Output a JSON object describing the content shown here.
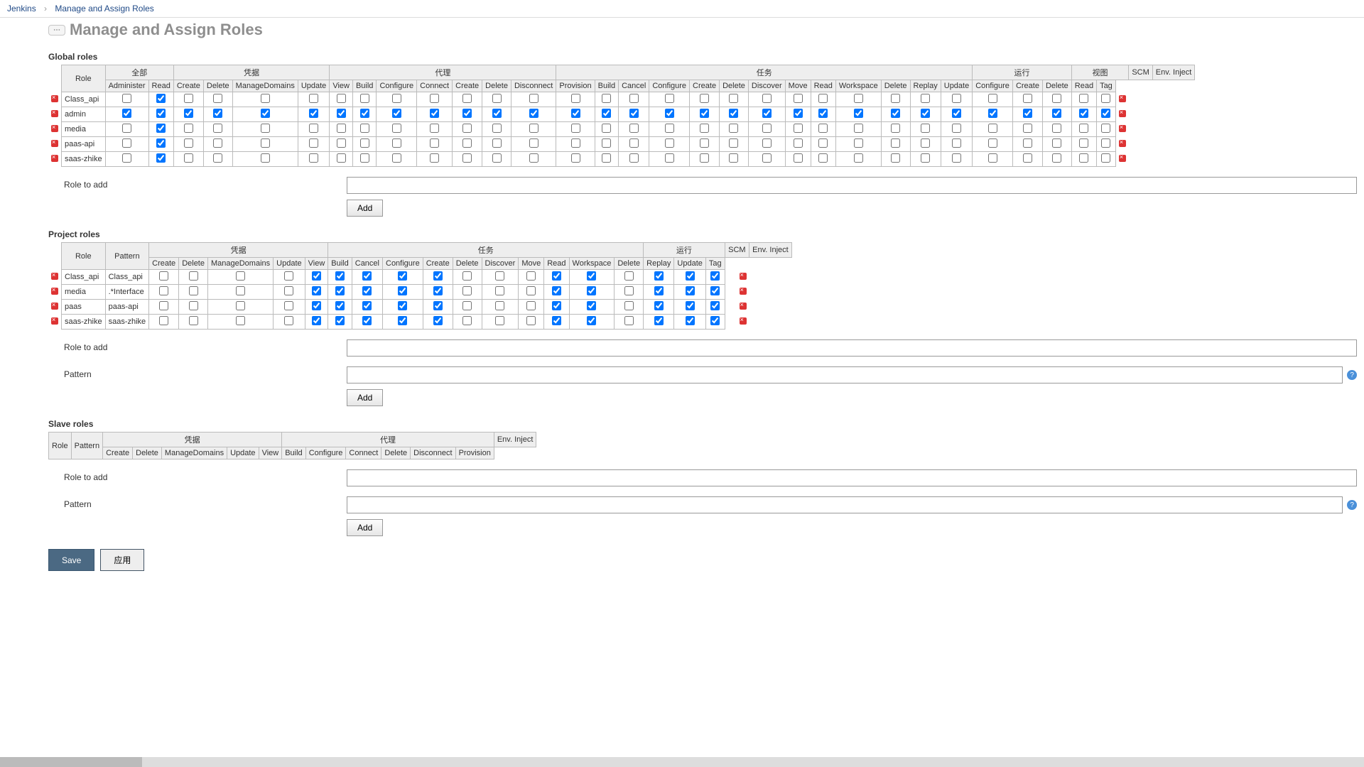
{
  "breadcrumb": {
    "root": "Jenkins",
    "page": "Manage and Assign Roles"
  },
  "title": "Manage and Assign Roles",
  "sections": {
    "global": "Global roles",
    "project": "Project roles",
    "slave": "Slave roles"
  },
  "labels": {
    "role_to_add": "Role to add",
    "pattern": "Pattern",
    "add": "Add",
    "save": "Save",
    "apply": "应用",
    "role": "Role",
    "pattern_col": "Pattern"
  },
  "global_groups": [
    "全部",
    "凭据",
    "代理",
    "任务",
    "运行",
    "视图",
    "SCM",
    "Env. Inject"
  ],
  "global_group_spans": [
    2,
    4,
    7,
    13,
    3,
    4,
    1,
    1
  ],
  "global_perms": [
    "Administer",
    "Read",
    "Create",
    "Delete",
    "ManageDomains",
    "Update",
    "View",
    "Build",
    "Configure",
    "Connect",
    "Create",
    "Delete",
    "Disconnect",
    "Provision",
    "Build",
    "Cancel",
    "Configure",
    "Create",
    "Delete",
    "Discover",
    "Move",
    "Read",
    "Workspace",
    "Delete",
    "Replay",
    "Update",
    "Configure",
    "Create",
    "Delete",
    "Read",
    "Tag"
  ],
  "global_roles": [
    {
      "name": "Class_api",
      "checks": [
        0,
        1,
        0,
        0,
        0,
        0,
        0,
        0,
        0,
        0,
        0,
        0,
        0,
        0,
        0,
        0,
        0,
        0,
        0,
        0,
        0,
        0,
        0,
        0,
        0,
        0,
        0,
        0,
        0,
        0,
        0
      ]
    },
    {
      "name": "admin",
      "checks": [
        1,
        1,
        1,
        1,
        1,
        1,
        1,
        1,
        1,
        1,
        1,
        1,
        1,
        1,
        1,
        1,
        1,
        1,
        1,
        1,
        1,
        1,
        1,
        1,
        1,
        1,
        1,
        1,
        1,
        1,
        1
      ]
    },
    {
      "name": "media",
      "checks": [
        0,
        1,
        0,
        0,
        0,
        0,
        0,
        0,
        0,
        0,
        0,
        0,
        0,
        0,
        0,
        0,
        0,
        0,
        0,
        0,
        0,
        0,
        0,
        0,
        0,
        0,
        0,
        0,
        0,
        0,
        0
      ]
    },
    {
      "name": "paas-api",
      "checks": [
        0,
        1,
        0,
        0,
        0,
        0,
        0,
        0,
        0,
        0,
        0,
        0,
        0,
        0,
        0,
        0,
        0,
        0,
        0,
        0,
        0,
        0,
        0,
        0,
        0,
        0,
        0,
        0,
        0,
        0,
        0
      ]
    },
    {
      "name": "saas-zhike",
      "checks": [
        0,
        1,
        0,
        0,
        0,
        0,
        0,
        0,
        0,
        0,
        0,
        0,
        0,
        0,
        0,
        0,
        0,
        0,
        0,
        0,
        0,
        0,
        0,
        0,
        0,
        0,
        0,
        0,
        0,
        0,
        0
      ]
    }
  ],
  "project_groups": [
    "凭据",
    "任务",
    "运行",
    "SCM",
    "Env. Inject"
  ],
  "project_group_spans": [
    5,
    10,
    3,
    1,
    1
  ],
  "project_perms": [
    "Create",
    "Delete",
    "ManageDomains",
    "Update",
    "View",
    "Build",
    "Cancel",
    "Configure",
    "Create",
    "Delete",
    "Discover",
    "Move",
    "Read",
    "Workspace",
    "Delete",
    "Replay",
    "Update",
    "Tag"
  ],
  "project_roles": [
    {
      "name": "Class_api",
      "pattern": "Class_api",
      "checks": [
        0,
        0,
        0,
        0,
        1,
        1,
        1,
        1,
        1,
        0,
        0,
        0,
        1,
        1,
        0,
        1,
        1,
        1
      ]
    },
    {
      "name": "media",
      "pattern": ".*Interface",
      "checks": [
        0,
        0,
        0,
        0,
        1,
        1,
        1,
        1,
        1,
        0,
        0,
        0,
        1,
        1,
        0,
        1,
        1,
        1
      ]
    },
    {
      "name": "paas",
      "pattern": "paas-api",
      "checks": [
        0,
        0,
        0,
        0,
        1,
        1,
        1,
        1,
        1,
        0,
        0,
        0,
        1,
        1,
        0,
        1,
        1,
        1
      ]
    },
    {
      "name": "saas-zhike",
      "pattern": "saas-zhike",
      "checks": [
        0,
        0,
        0,
        0,
        1,
        1,
        1,
        1,
        1,
        0,
        0,
        0,
        1,
        1,
        0,
        1,
        1,
        1
      ]
    }
  ],
  "slave_groups": [
    "凭据",
    "代理",
    "Env. Inject"
  ],
  "slave_group_spans": [
    5,
    6,
    1
  ],
  "slave_perms": [
    "Create",
    "Delete",
    "ManageDomains",
    "Update",
    "View",
    "Build",
    "Configure",
    "Connect",
    "Delete",
    "Disconnect",
    "Provision"
  ]
}
